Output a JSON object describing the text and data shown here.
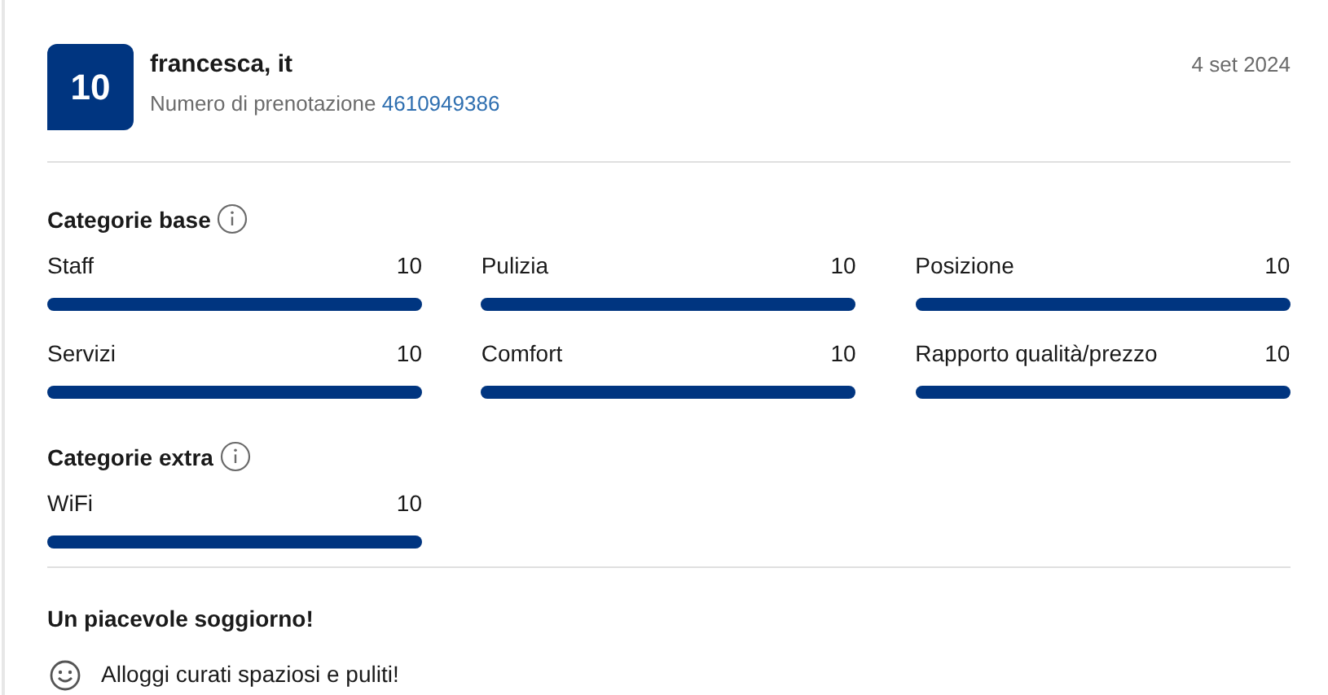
{
  "review": {
    "score": "10",
    "reviewer": "francesca, it",
    "booking_label": "Numero di prenotazione",
    "booking_number": "4610949386",
    "date": "4 set 2024"
  },
  "category_groups": [
    {
      "title": "Categorie base",
      "categories": [
        {
          "name": "Staff",
          "score": "10",
          "level": 1
        },
        {
          "name": "Pulizia",
          "score": "10",
          "level": 1
        },
        {
          "name": "Posizione",
          "score": "10",
          "level": 1
        },
        {
          "name": "Servizi",
          "score": "10",
          "level": 1
        },
        {
          "name": "Comfort",
          "score": "10",
          "level": 1
        },
        {
          "name": "Rapporto qualità/prezzo",
          "score": "10",
          "level": 1
        }
      ]
    },
    {
      "title": "Categorie extra",
      "categories": [
        {
          "name": "WiFi",
          "score": "10",
          "level": 1
        }
      ]
    }
  ],
  "comment": {
    "title": "Un piacevole soggiorno!",
    "positive": "Alloggi curati spaziosi e puliti!"
  }
}
